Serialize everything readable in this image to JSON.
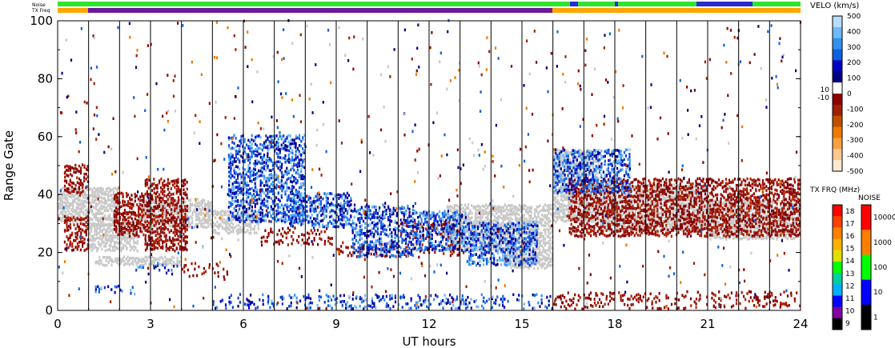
{
  "chart_data": {
    "type": "scatter",
    "xlabel": "UT hours",
    "ylabel": "Range Gate",
    "xlim": [
      0,
      24
    ],
    "ylim": [
      0,
      100
    ],
    "xticks": [
      "0",
      "3",
      "6",
      "9",
      "12",
      "15",
      "18",
      "21",
      "24"
    ],
    "yticks": [
      "0",
      "20",
      "40",
      "60",
      "80",
      "100"
    ],
    "top_bars": {
      "noise_label": "Noise",
      "txfreq_label": "TX Freq"
    },
    "velo": {
      "title": "VELO (km/s)",
      "ticks": [
        "500",
        "400",
        "300",
        "200",
        "100",
        "0",
        "-100",
        "-200",
        "-300",
        "-400",
        "-500"
      ],
      "side_labels": [
        "10",
        "-10"
      ],
      "colors": [
        "#ffe8d0",
        "#ffc890",
        "#f8a040",
        "#f07800",
        "#c05000",
        "#a02000",
        "#8c0000",
        "#ffffff",
        "#000080",
        "#0000c0",
        "#1060e0",
        "#3090f0",
        "#70b8f8",
        "#b8dcff"
      ]
    },
    "txfreq": {
      "title": "TX FRQ (MHz)",
      "ticks": [
        "18",
        "17",
        "16",
        "15",
        "14",
        "13",
        "12",
        "11",
        "10",
        "9"
      ],
      "colors": [
        "#ff0000",
        "#ff4000",
        "#ff8000",
        "#ffb000",
        "#e0e000",
        "#00ff00",
        "#00d0a0",
        "#00b0ff",
        "#0000ff",
        "#8000a0",
        "#000000"
      ]
    },
    "noise": {
      "title": "NOISE",
      "ticks": [
        "10000",
        "1000",
        "100",
        "10",
        "1"
      ],
      "colors": [
        "#ff0000",
        "#ff8000",
        "#00ff00",
        "#0000ff",
        "#000000"
      ]
    },
    "ground_scatter_color": "#c8c8c8",
    "bands": [
      {
        "kind": "ground",
        "t0": 0.0,
        "t1": 2.0,
        "r0": 30,
        "r1": 42
      },
      {
        "kind": "ground",
        "t0": 1.0,
        "t1": 2.6,
        "r0": 20,
        "r1": 30
      },
      {
        "kind": "ground",
        "t0": 2.6,
        "t1": 5.0,
        "r0": 28,
        "r1": 38
      },
      {
        "kind": "ground",
        "t0": 5.0,
        "t1": 6.5,
        "r0": 26,
        "r1": 34
      },
      {
        "kind": "ground",
        "t0": 12.5,
        "t1": 16.0,
        "r0": 20,
        "r1": 36
      },
      {
        "kind": "ground",
        "t0": 16.0,
        "t1": 17.5,
        "r0": 30,
        "r1": 55
      },
      {
        "kind": "ground",
        "t0": 17.5,
        "t1": 21.0,
        "r0": 27,
        "r1": 43
      },
      {
        "kind": "ground",
        "t0": 21.0,
        "t1": 24.0,
        "r0": 24,
        "r1": 38
      },
      {
        "kind": "ground",
        "t0": 14.5,
        "t1": 16.0,
        "r0": 14,
        "r1": 20
      },
      {
        "kind": "ground",
        "t0": 1.2,
        "t1": 4.0,
        "r0": 15,
        "r1": 18
      },
      {
        "kind": "neg",
        "t0": 2.8,
        "t1": 4.2,
        "r0": 20,
        "r1": 45
      },
      {
        "kind": "neg",
        "t0": 1.8,
        "t1": 2.8,
        "r0": 25,
        "r1": 40
      },
      {
        "kind": "neg",
        "t0": 0.2,
        "t1": 1.0,
        "r0": 40,
        "r1": 50
      },
      {
        "kind": "neg",
        "t0": 0.2,
        "t1": 1.0,
        "r0": 20,
        "r1": 32
      },
      {
        "kind": "neg",
        "t0": 6.5,
        "t1": 9.0,
        "r0": 22,
        "r1": 28
      },
      {
        "kind": "neg",
        "t0": 9.0,
        "t1": 13.0,
        "r0": 18,
        "r1": 23
      },
      {
        "kind": "neg",
        "t0": 11.0,
        "t1": 13.0,
        "r0": 24,
        "r1": 30
      },
      {
        "kind": "neg",
        "t0": 4.0,
        "t1": 5.5,
        "r0": 11,
        "r1": 16
      },
      {
        "kind": "neg",
        "t0": 16.5,
        "t1": 24.0,
        "r0": 25,
        "r1": 45
      },
      {
        "kind": "pos",
        "t0": 5.5,
        "t1": 8.0,
        "r0": 30,
        "r1": 60
      },
      {
        "kind": "pos",
        "t0": 7.5,
        "t1": 9.5,
        "r0": 28,
        "r1": 40
      },
      {
        "kind": "pos",
        "t0": 9.5,
        "t1": 11.5,
        "r0": 18,
        "r1": 36
      },
      {
        "kind": "pos",
        "t0": 11.5,
        "t1": 13.2,
        "r0": 20,
        "r1": 34
      },
      {
        "kind": "pos",
        "t0": 13.2,
        "t1": 15.5,
        "r0": 15,
        "r1": 30
      },
      {
        "kind": "pos",
        "t0": 2.5,
        "t1": 4.0,
        "r0": 12,
        "r1": 16
      },
      {
        "kind": "pos",
        "t0": 1.2,
        "t1": 2.5,
        "r0": 5,
        "r1": 8
      },
      {
        "kind": "pos",
        "t0": 5.0,
        "t1": 16.0,
        "r0": 0,
        "r1": 5
      },
      {
        "kind": "neg",
        "t0": 16.0,
        "t1": 24.0,
        "r0": 0,
        "r1": 6
      },
      {
        "kind": "pos",
        "t0": 16.0,
        "t1": 18.5,
        "r0": 40,
        "r1": 55
      }
    ]
  }
}
